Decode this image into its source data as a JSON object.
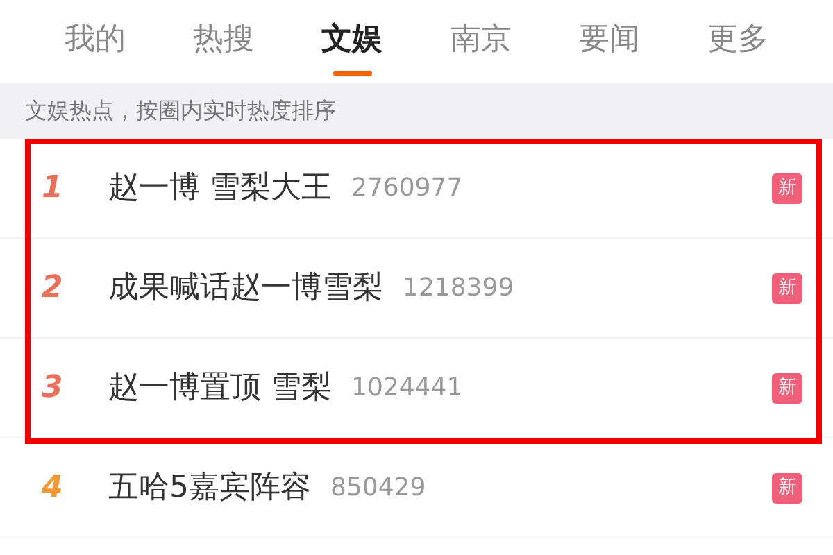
{
  "tabs": [
    {
      "label": "我的",
      "selected": false
    },
    {
      "label": "热搜",
      "selected": false
    },
    {
      "label": "文娱",
      "selected": true
    },
    {
      "label": "南京",
      "selected": false
    },
    {
      "label": "要闻",
      "selected": false
    },
    {
      "label": "更多",
      "selected": false
    }
  ],
  "subtitle": "文娱热点，按圈内实时热度排序",
  "rows": [
    {
      "rank": "1",
      "color": "#e8705a",
      "title": "赵一博 雪梨大王",
      "count": "2760977",
      "badge": "新",
      "highlighted": true
    },
    {
      "rank": "2",
      "color": "#e8705a",
      "title": "成果喊话赵一博雪梨",
      "count": "1218399",
      "badge": "新",
      "highlighted": true
    },
    {
      "rank": "3",
      "color": "#e8705a",
      "title": "赵一博置顶 雪梨",
      "count": "1024441",
      "badge": "新",
      "highlighted": true
    },
    {
      "rank": "4",
      "color": "#f09a37",
      "title": "五哈5嘉宾阵容",
      "count": "850429",
      "badge": "新",
      "highlighted": false
    }
  ]
}
